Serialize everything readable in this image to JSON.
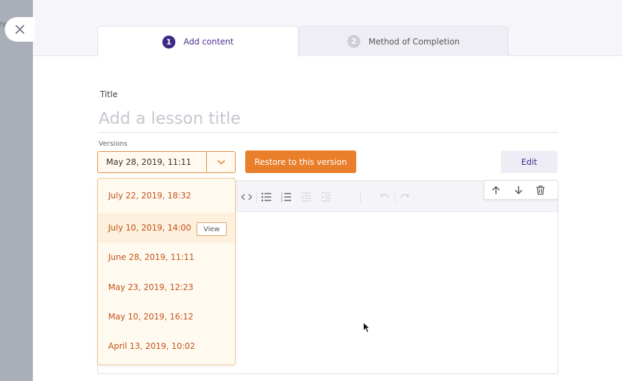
{
  "backdrop": {
    "partial_text": "ey"
  },
  "tabs": [
    {
      "number": "1",
      "label": "Add content",
      "active": true
    },
    {
      "number": "2",
      "label": "Method of Completion",
      "active": false
    }
  ],
  "form": {
    "title_label": "Title",
    "title_placeholder": "Add a lesson title",
    "title_value": "",
    "versions_label": "Versions",
    "selected_version": "May 28, 2019, 11:11"
  },
  "buttons": {
    "restore": "Restore to this version",
    "edit": "Edit",
    "view": "View"
  },
  "version_options": [
    "July 22, 2019, 18:32",
    "July 10, 2019, 14:00",
    "June 28, 2019, 11:11",
    "May 23, 2019, 12:23",
    "May 10, 2019, 16:12",
    "April 13, 2019, 10:02"
  ],
  "toolbar_icons": [
    "code-icon",
    "bulleted-list-icon",
    "numbered-list-icon",
    "outdent-icon",
    "indent-icon",
    "undo-icon",
    "redo-icon"
  ],
  "block_controls": [
    "arrow-up-icon",
    "arrow-down-icon",
    "trash-icon"
  ],
  "colors": {
    "accent_purple": "#3d2a85",
    "accent_orange": "#e97f2b",
    "dropdown_text": "#c4501b",
    "dropdown_bg": "#fffaef"
  }
}
